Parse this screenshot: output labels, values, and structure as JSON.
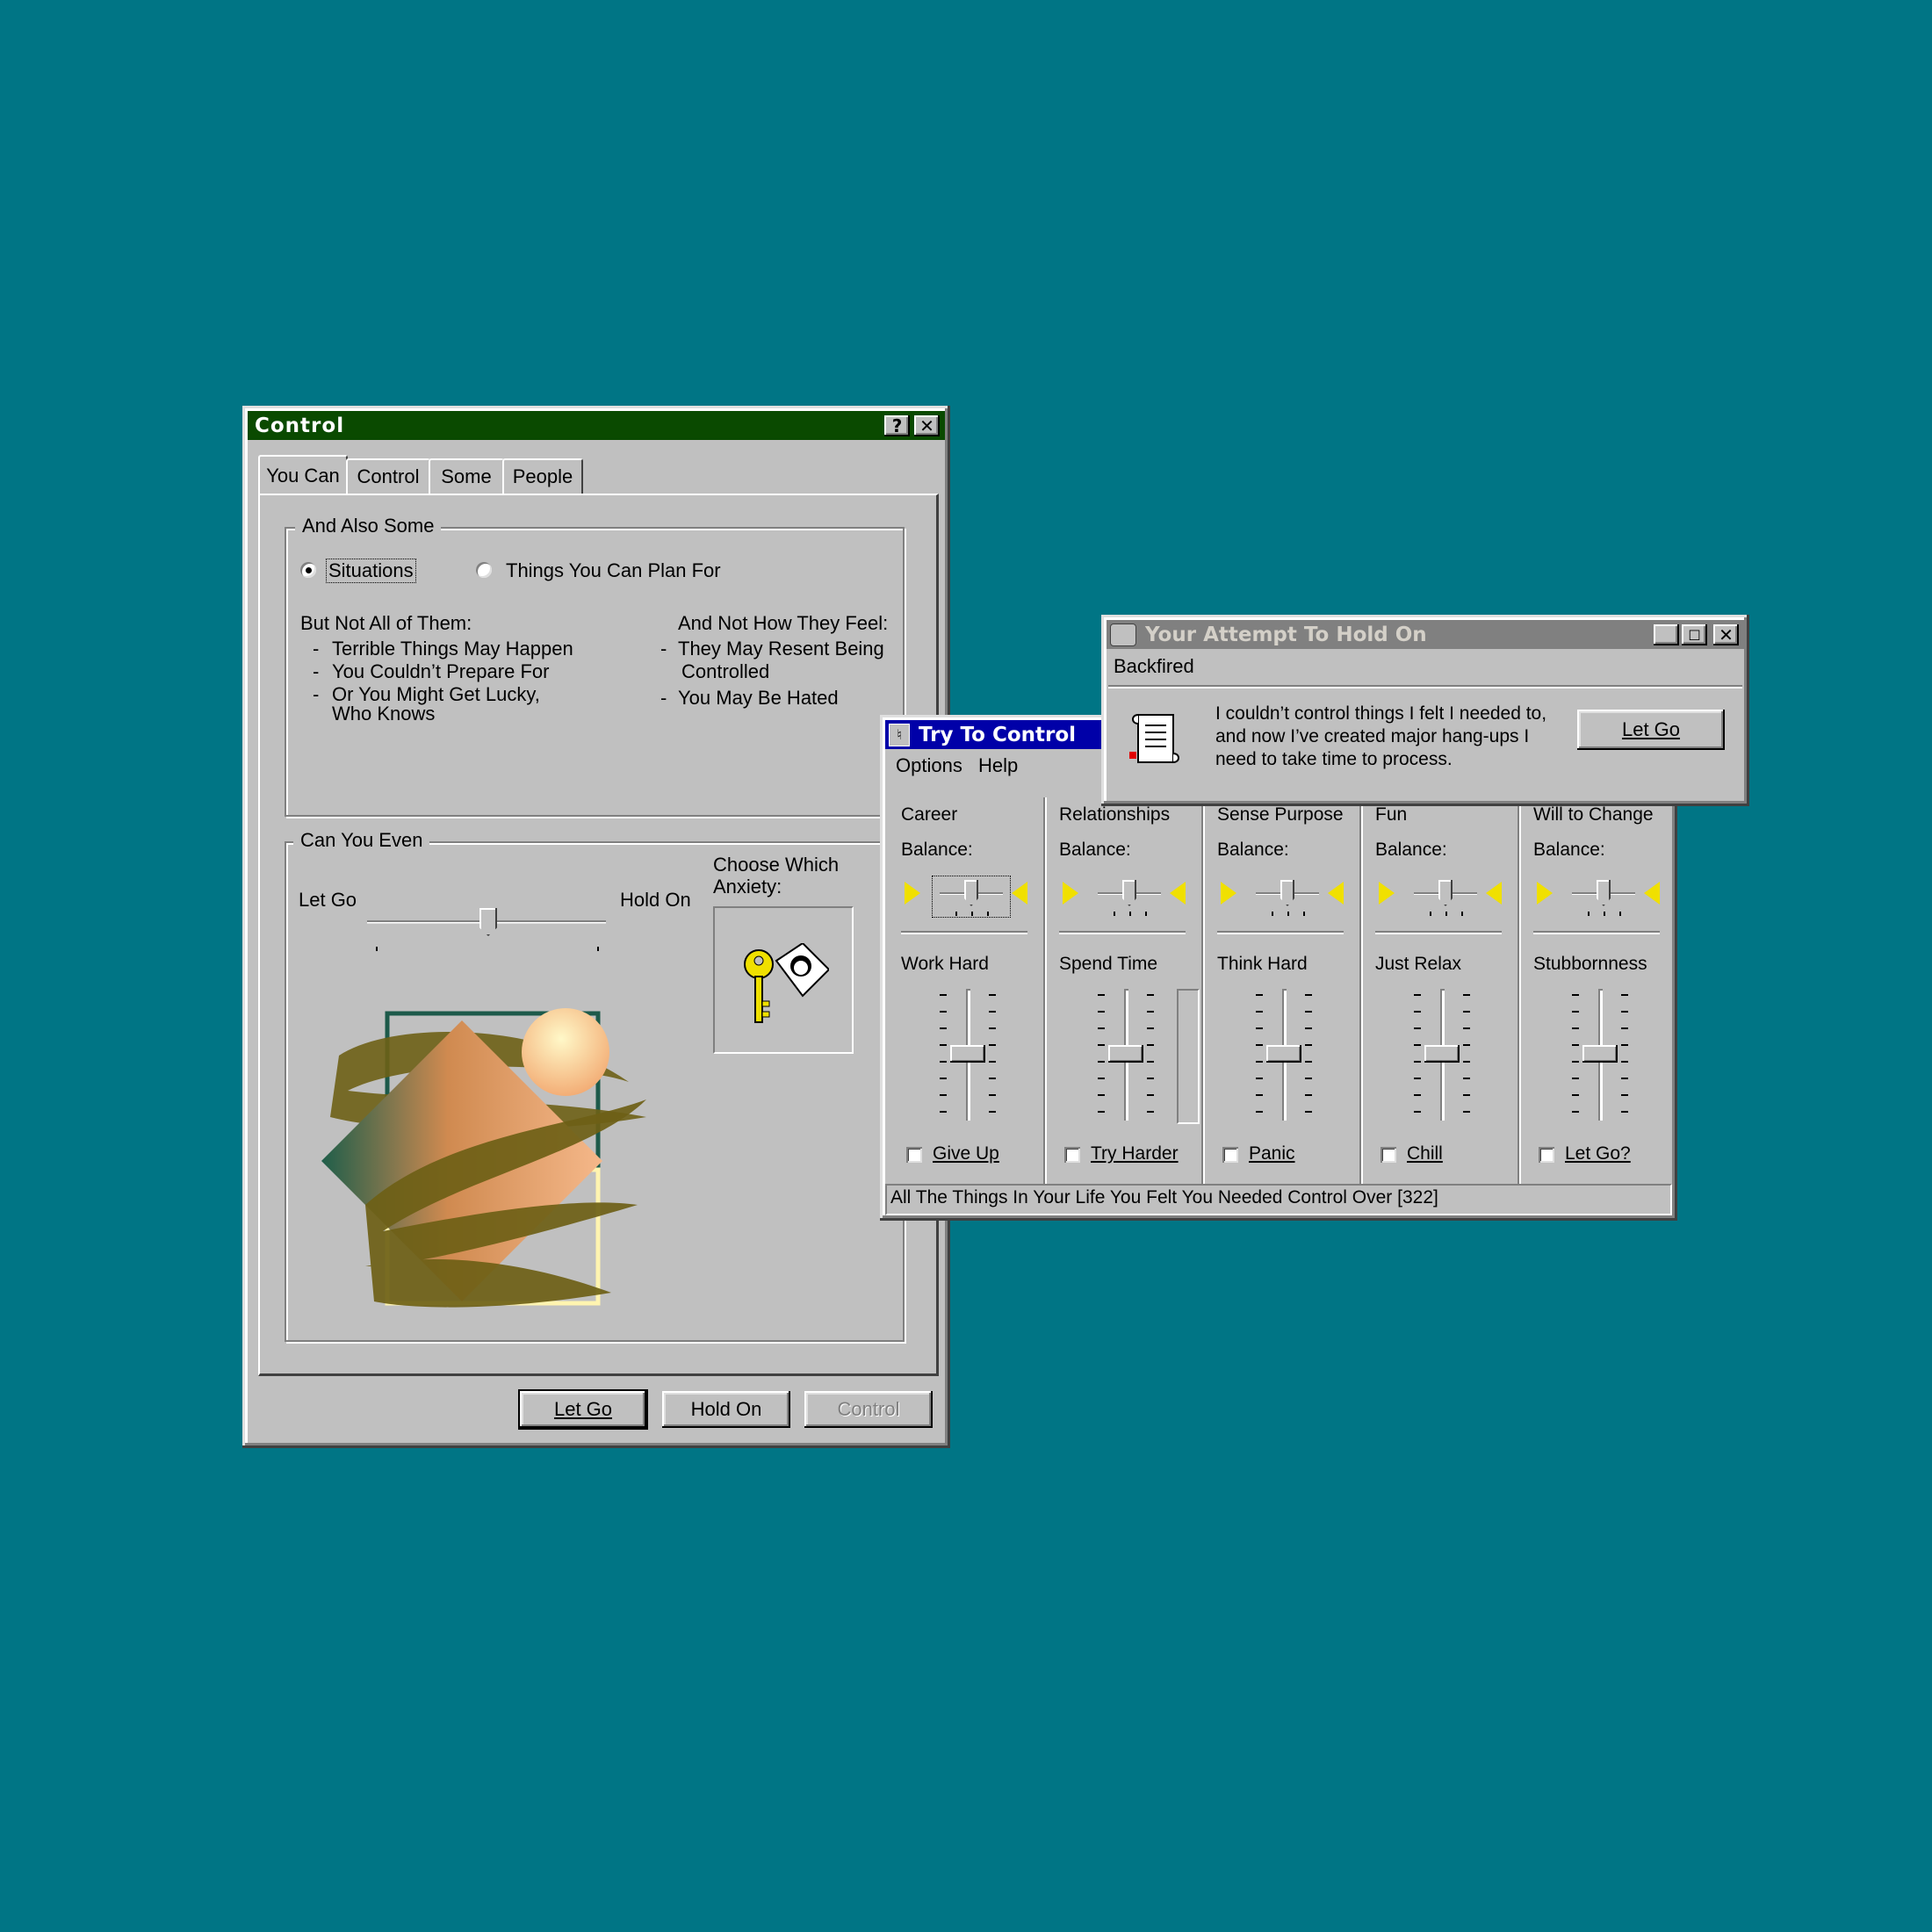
{
  "control_window": {
    "title": "Control",
    "tabs": [
      "You Can",
      "Control",
      "Some",
      "People"
    ],
    "group1": {
      "legend": "And Also Some",
      "radio1": "Situations",
      "radio2": "Things You Can Plan For",
      "left_heading": "But Not All of Them:",
      "left_items": [
        "Terrible Things May Happen",
        "You Couldn’t Prepare For",
        "Or You Might Get Lucky,",
        "Who Knows"
      ],
      "right_heading": "And Not How They Feel:",
      "right_items": [
        "They May Resent Being",
        "Controlled",
        "You May Be Hated"
      ]
    },
    "group2": {
      "legend": "Can You Even",
      "slider_left": "Let Go",
      "slider_right": "Hold On",
      "slider_value": 0.5,
      "choose_label_1": "Choose Which",
      "choose_label_2": "Anxiety:"
    },
    "buttons": {
      "let_go": "Let Go",
      "hold_on": "Hold On",
      "control": "Control"
    }
  },
  "mixer_window": {
    "title": "Try To Control",
    "menu": [
      "Options",
      "Help"
    ],
    "balance_label": "Balance:",
    "columns": [
      {
        "name": "Career",
        "slider": "Work Hard",
        "check": "Give Up"
      },
      {
        "name": "Relationships",
        "slider": "Spend Time",
        "check": "Try Harder"
      },
      {
        "name": "Sense Purpose",
        "slider": "Think Hard",
        "check": "Panic"
      },
      {
        "name": "Fun",
        "slider": "Just Relax",
        "check": "Chill"
      },
      {
        "name": "Will to Change",
        "slider": "Stubbornness",
        "check": "Let Go?"
      }
    ],
    "status": "All The Things In Your Life You Felt You Needed Control Over [322]"
  },
  "dialog_window": {
    "title": "Your Attempt To Hold On",
    "menu": "Backfired",
    "message_1": "I couldn’t control things I felt I needed to,",
    "message_2": "and now I’ve created major hang-ups I",
    "message_3": "need to take time to process.",
    "button": "Let Go"
  },
  "colors": {
    "desktop": "#007585",
    "control_title": "#0a4a00",
    "mixer_title": "#0000a8",
    "dialog_title": "#808080"
  }
}
